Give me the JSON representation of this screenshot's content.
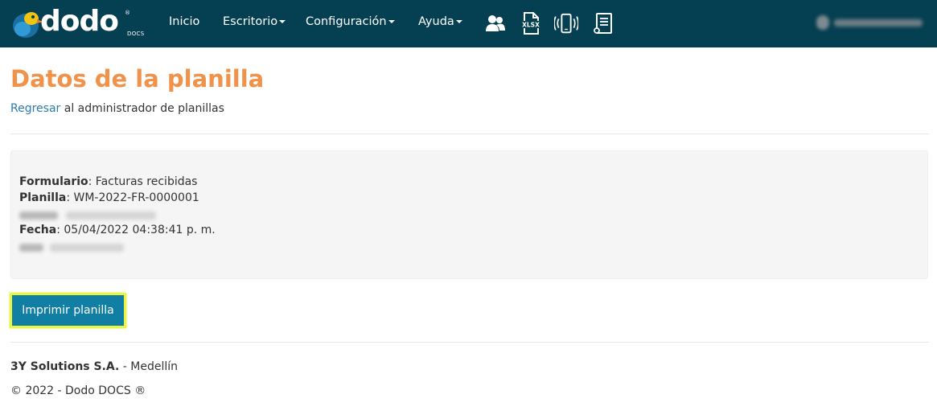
{
  "brand": {
    "name": "dodo",
    "suffix": "DOCS",
    "reg": "®"
  },
  "nav": {
    "inicio": "Inicio",
    "escritorio": "Escritorio",
    "configuracion": "Configuración",
    "ayuda": "Ayuda",
    "icons": [
      "users-icon",
      "xlsx-icon",
      "mobile-vibrate-icon",
      "document-list-icon"
    ]
  },
  "header": {
    "title": "Datos de la planilla",
    "back_link": "Regresar",
    "back_rest": " al administrador de planillas"
  },
  "details": {
    "formulario_label": "Formulario",
    "formulario_value": ": Facturas recibidas",
    "planilla_label": "Planilla",
    "planilla_value": ": WM-2022-FR-0000001",
    "fecha_label": "Fecha",
    "fecha_value": ": 05/04/2022 04:38:41 p. m."
  },
  "actions": {
    "print_label": "Imprimir planilla"
  },
  "footer": {
    "company": "3Y Solutions S.A.",
    "city": " - Medellín",
    "copyright": "© 2022 - Dodo DOCS ®"
  },
  "colors": {
    "navbar": "#053f52",
    "title": "#f0924a",
    "link": "#2a7ab0",
    "button": "#117ea3",
    "highlight": "#e9f542"
  }
}
